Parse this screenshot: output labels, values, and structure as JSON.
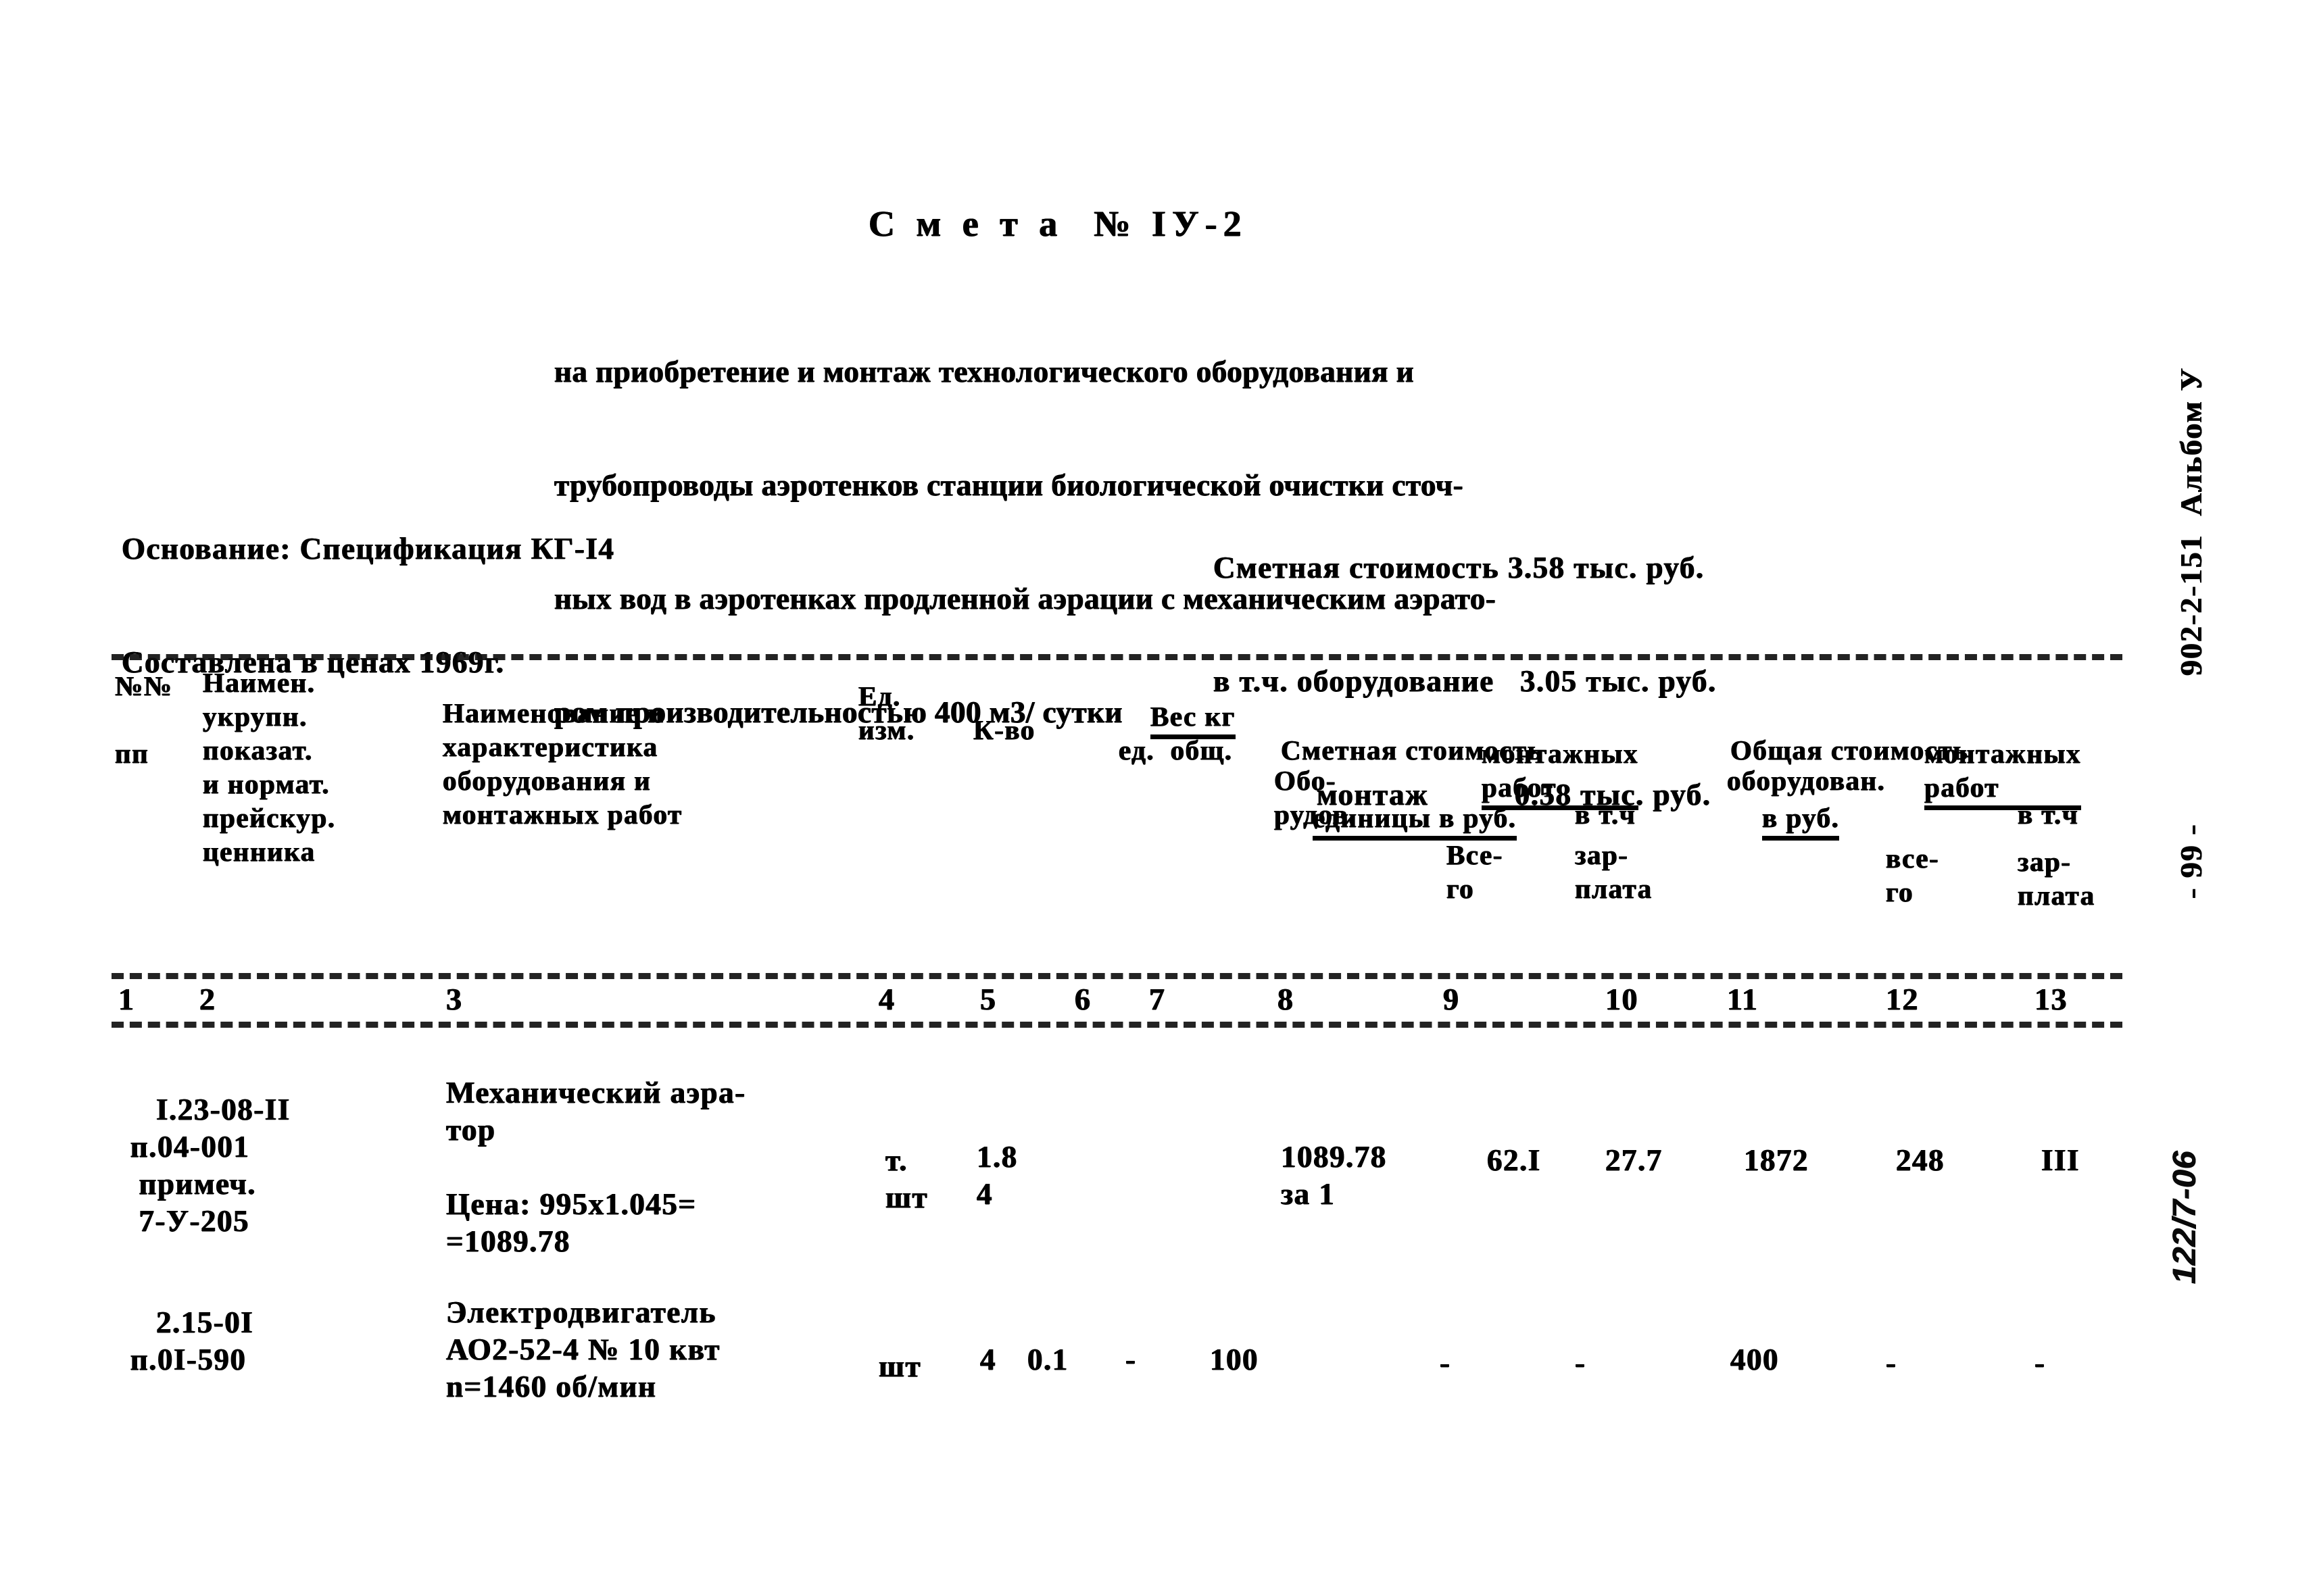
{
  "document": {
    "title": "С м е т а  № IУ-2",
    "subtitle_lines": [
      "на приобретение и монтаж технологического оборудования и",
      "трубопроводы аэротенков станции биологической очистки сточ-",
      "ных вод в аэротенках продленной аэрации с механическим аэрато-",
      "ром производительностью 400 м3/ сутки"
    ],
    "basis_lines": [
      "Основание: Спецификация КГ-I4",
      "Составлена в ценах 1969г."
    ],
    "cost_summary_lines": [
      "Сметная стоимость 3.58 тыс. руб.",
      "в т.ч. оборудование   3.05 тыс. руб.",
      "            монтаж          0.58 тыс. руб."
    ]
  },
  "table": {
    "header": {
      "col1_no": "№№",
      "col1_no2": "пп",
      "col2_code": "Наимен.\nукрупн.\nпоказат.\nи нормат.\nпрейскур.\nценника",
      "col3_desc": "Наименование и\nхарактеристика\nоборудования и\nмонтажных работ",
      "col4_unit": "Ед.\nизм.",
      "col5_qty": "К-во",
      "col67_weight_title": "Вес кг",
      "col67_weight_sub": "ед.  общ.",
      "col8_13_unit_cost_title": "Сметная стоимость",
      "col8_13_unit_cost_sub": "единицы в руб.",
      "col8_equip": "Обо-\nрудов.",
      "col9_mont": "монтажных\nработ",
      "col10_vtch": "в т.ч",
      "col9_vsego": "Все-\nго",
      "col10_zarplata": "зар-\nплата",
      "col11_13_total_title": "Общая стоимость",
      "col11_13_total_sub": "в руб.",
      "col11_equip": "оборудован.",
      "col12_mont": "монтажных\nработ",
      "col13_vtch": "в т.ч",
      "col12_vsego": "все-\nго",
      "col13_zarplata": "зар-\nплата"
    },
    "column_numbers": [
      "1",
      "2",
      "3",
      "4",
      "5",
      "6",
      "7",
      "8",
      "9",
      "10",
      "11",
      "12",
      "13"
    ],
    "rows": [
      {
        "code": "I.23-08-II\n п.04-001\n  примеч.\n  7-У-205",
        "description": "Механический аэра-\nтор",
        "price_note": "Цена: 995х1.045=\n=1089.78",
        "unit": "т.\nшт",
        "qty": "1.8\n4",
        "col6": "",
        "col7": "",
        "col8": "1089.78\nза 1",
        "col9": "62.I",
        "col10": "27.7",
        "col11": "1872",
        "col12": "248",
        "col13": "III"
      },
      {
        "code": "2.15-0I\n п.0I-590",
        "description": "Электродвигатель\nАО2-52-4 № 10 квт\nn=1460 об/мин",
        "price_note": "",
        "unit": "шт",
        "qty": "4",
        "col6": "0.1",
        "col7": "-",
        "col8": "100",
        "col9": "-",
        "col10": "-",
        "col11": "400",
        "col12": "-",
        "col13": "-"
      }
    ]
  },
  "margin": {
    "document_code": "902-2-151  Альбом У",
    "page_number": "- 99 -",
    "stamp": "122/7-06"
  }
}
